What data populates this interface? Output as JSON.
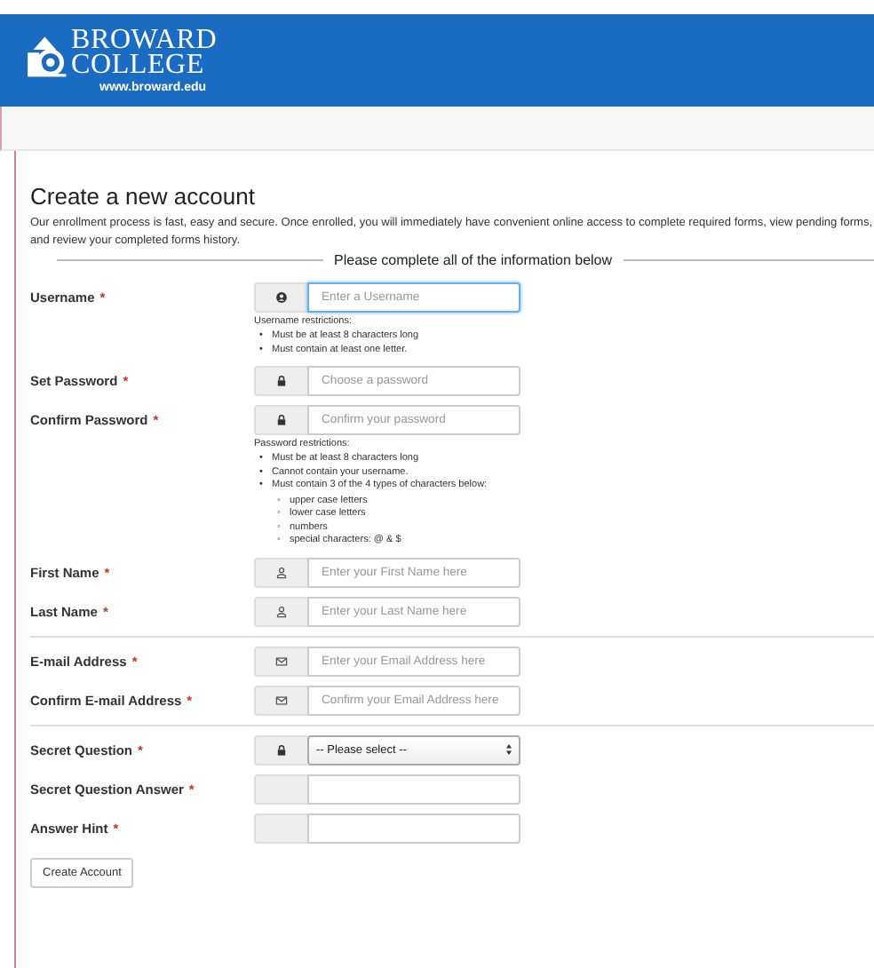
{
  "header": {
    "logo_lines": [
      "BROWARD",
      "COLLEGE"
    ],
    "url": "www.broward.edu"
  },
  "heading": "Create a new account",
  "intro": "Our enrollment process is fast, easy and secure. Once enrolled, you will immediately have convenient online access to complete required forms, view pending forms, and review your completed forms history.",
  "section_title": "Please complete all of the information below",
  "groups": [
    [
      {
        "label": "Username",
        "star": "*",
        "kind": "username",
        "placeholder": "Enter a Username",
        "focused": true,
        "notes": {
          "title": "Username restrictions:",
          "items": [
            {
              "marker": "•",
              "text": "Must be at least 8 characters long"
            },
            {
              "marker": "•",
              "text": "Must contain at least one letter."
            }
          ]
        }
      },
      {
        "label": "Set Password",
        "star": "*",
        "kind": "password",
        "placeholder": "Choose a password",
        "focused": false
      },
      {
        "label": "Confirm Password",
        "star": "*",
        "kind": "password",
        "placeholder": "Confirm your password",
        "focused": false,
        "notes": {
          "title": "Password restrictions:",
          "items": [
            {
              "marker": "•",
              "text": "Must be at least 8 characters long"
            },
            {
              "marker": "•",
              "text": "Cannot contain your username."
            },
            {
              "marker": "•",
              "text": "Must contain 3 of the 4 types of characters below:",
              "children": [
                {
                  "marker": "◦",
                  "text": "upper case letters"
                },
                {
                  "marker": "◦",
                  "text": "lower case letters"
                },
                {
                  "marker": "◦",
                  "text": "numbers"
                },
                {
                  "marker": "◦",
                  "text": "special characters: @ & $"
                }
              ]
            }
          ]
        }
      },
      {
        "label": "First Name",
        "star": "*",
        "kind": "name",
        "placeholder": "Enter your First Name here",
        "focused": false
      },
      {
        "label": "Last Name",
        "star": "*",
        "kind": "name",
        "placeholder": "Enter your Last Name here",
        "focused": false
      }
    ],
    [
      {
        "label": "E-mail Address",
        "star": "*",
        "kind": "email",
        "placeholder": "Enter your Email Address here",
        "focused": false
      },
      {
        "label": "Confirm E-mail Address",
        "star": "*",
        "kind": "email",
        "placeholder": "Confirm your Email Address here",
        "focused": false
      }
    ],
    [
      {
        "label": "Secret Question",
        "star": "*",
        "kind": "question",
        "value": "-- Please select --",
        "focused": false
      },
      {
        "label": "Secret Question Answer",
        "star": "*",
        "kind": "answer",
        "focused": false
      },
      {
        "label": "Answer Hint",
        "star": "*",
        "kind": "answer",
        "focused": false
      }
    ]
  ],
  "submit": "Create Account"
}
